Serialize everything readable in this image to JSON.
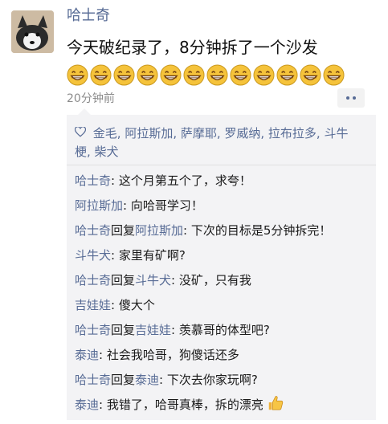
{
  "post": {
    "author": "哈士奇",
    "text": "今天破纪录了，8分钟拆了一个沙发",
    "emoji_count": 12,
    "emoji_icon": "grinning-face-icon",
    "time": "20分钟前"
  },
  "likes": {
    "icon": "heart-outline-icon",
    "names": "金毛, 阿拉斯加, 萨摩耶, 罗威纳, 拉布拉多, 斗牛梗, 柴犬"
  },
  "comments": [
    {
      "author": "哈士奇",
      "reply_word": "",
      "reply_to": "",
      "sep": ": ",
      "text": "这个月第五个了，求夸！"
    },
    {
      "author": "阿拉斯加",
      "reply_word": "",
      "reply_to": "",
      "sep": ": ",
      "text": "向哈哥学习！"
    },
    {
      "author": "哈士奇",
      "reply_word": "回复",
      "reply_to": "阿拉斯加",
      "sep": ": ",
      "text": "下次的目标是5分钟拆完！"
    },
    {
      "author": "斗牛犬",
      "reply_word": "",
      "reply_to": "",
      "sep": ": ",
      "text": "家里有矿啊?"
    },
    {
      "author": "哈士奇",
      "reply_word": "回复",
      "reply_to": "斗牛犬",
      "sep": ": ",
      "text": "没矿，只有我"
    },
    {
      "author": "吉娃娃",
      "reply_word": "",
      "reply_to": "",
      "sep": ": ",
      "text": "傻大个"
    },
    {
      "author": "哈士奇",
      "reply_word": "回复",
      "reply_to": "吉娃娃",
      "sep": ": ",
      "text": "羡慕哥的体型吧?"
    },
    {
      "author": "泰迪",
      "reply_word": "",
      "reply_to": "",
      "sep": ": ",
      "text": "社会我哈哥，狗傻话还多"
    },
    {
      "author": "哈士奇",
      "reply_word": "回复",
      "reply_to": "泰迪",
      "sep": ": ",
      "text": "下次去你家玩啊?"
    },
    {
      "author": "泰迪",
      "reply_word": "",
      "reply_to": "",
      "sep": ": ",
      "text": "我错了，哈哥真棒，拆的漂亮"
    }
  ],
  "last_comment_icon": "thumbs-up-icon",
  "colors": {
    "link": "#576b95",
    "comment_bg": "#f3f3f5",
    "emoji": "#f5c33b"
  }
}
